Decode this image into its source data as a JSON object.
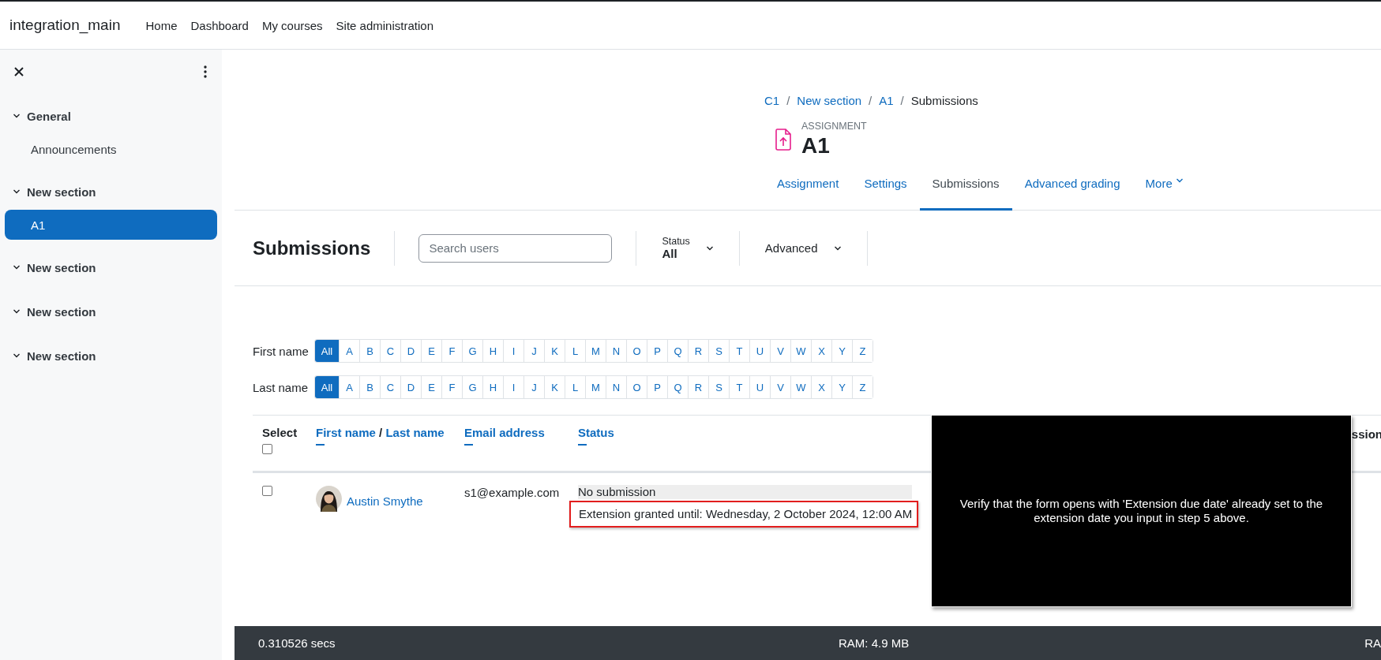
{
  "navbar": {
    "site_name": "integration_main",
    "links": [
      {
        "label": "Home"
      },
      {
        "label": "Dashboard"
      },
      {
        "label": "My courses"
      },
      {
        "label": "Site administration"
      }
    ]
  },
  "course_index": {
    "sections": [
      {
        "title": "General",
        "expanded": true,
        "items": [
          {
            "label": "Announcements",
            "selected": false
          }
        ]
      },
      {
        "title": "New section",
        "expanded": true,
        "items": [
          {
            "label": "A1",
            "selected": true
          }
        ]
      },
      {
        "title": "New section",
        "expanded": true
      },
      {
        "title": "New section",
        "expanded": true
      },
      {
        "title": "New section",
        "expanded": true
      }
    ]
  },
  "breadcrumb": [
    {
      "label": "C1",
      "link": true
    },
    {
      "separator_before": "/",
      "label": "New section",
      "link": true
    },
    {
      "separator_before": "/",
      "label": "A1",
      "link": true
    },
    {
      "separator_before": "/",
      "label": "Submissions",
      "link": false
    }
  ],
  "activity": {
    "type_label": "ASSIGNMENT",
    "title": "A1"
  },
  "tabs": [
    {
      "label": "Assignment",
      "selected": false,
      "has_menu": false
    },
    {
      "label": "Settings",
      "selected": false,
      "has_menu": false
    },
    {
      "label": "Submissions",
      "selected": true,
      "has_menu": false
    },
    {
      "label": "Advanced grading",
      "selected": false,
      "has_menu": false
    },
    {
      "label": "More",
      "selected": false,
      "has_menu": true
    }
  ],
  "toolbar": {
    "heading": "Submissions",
    "search": {
      "placeholder": "Search users"
    },
    "status_filter": {
      "label": "Status",
      "value": "All"
    },
    "advanced": {
      "label": "Advanced"
    }
  },
  "initials_bars": [
    {
      "label": "First name",
      "letters": [
        {
          "text": "All",
          "selected": true
        },
        {
          "text": "A",
          "selected": false
        },
        {
          "text": "B",
          "selected": false
        },
        {
          "text": "C",
          "selected": false
        },
        {
          "text": "D",
          "selected": false
        },
        {
          "text": "E",
          "selected": false
        },
        {
          "text": "F",
          "selected": false
        },
        {
          "text": "G",
          "selected": false
        },
        {
          "text": "H",
          "selected": false
        },
        {
          "text": "I",
          "selected": false
        },
        {
          "text": "J",
          "selected": false
        },
        {
          "text": "K",
          "selected": false
        },
        {
          "text": "L",
          "selected": false
        },
        {
          "text": "M",
          "selected": false
        },
        {
          "text": "N",
          "selected": false
        },
        {
          "text": "O",
          "selected": false
        },
        {
          "text": "P",
          "selected": false
        },
        {
          "text": "Q",
          "selected": false
        },
        {
          "text": "R",
          "selected": false
        },
        {
          "text": "S",
          "selected": false
        },
        {
          "text": "T",
          "selected": false
        },
        {
          "text": "U",
          "selected": false
        },
        {
          "text": "V",
          "selected": false
        },
        {
          "text": "W",
          "selected": false
        },
        {
          "text": "X",
          "selected": false
        },
        {
          "text": "Y",
          "selected": false
        },
        {
          "text": "Z",
          "selected": false
        }
      ]
    },
    {
      "label": "Last name",
      "letters": [
        {
          "text": "All",
          "selected": true
        },
        {
          "text": "A",
          "selected": false
        },
        {
          "text": "B",
          "selected": false
        },
        {
          "text": "C",
          "selected": false
        },
        {
          "text": "D",
          "selected": false
        },
        {
          "text": "E",
          "selected": false
        },
        {
          "text": "F",
          "selected": false
        },
        {
          "text": "G",
          "selected": false
        },
        {
          "text": "H",
          "selected": false
        },
        {
          "text": "I",
          "selected": false
        },
        {
          "text": "J",
          "selected": false
        },
        {
          "text": "K",
          "selected": false
        },
        {
          "text": "L",
          "selected": false
        },
        {
          "text": "M",
          "selected": false
        },
        {
          "text": "N",
          "selected": false
        },
        {
          "text": "O",
          "selected": false
        },
        {
          "text": "P",
          "selected": false
        },
        {
          "text": "Q",
          "selected": false
        },
        {
          "text": "R",
          "selected": false
        },
        {
          "text": "S",
          "selected": false
        },
        {
          "text": "T",
          "selected": false
        },
        {
          "text": "U",
          "selected": false
        },
        {
          "text": "V",
          "selected": false
        },
        {
          "text": "W",
          "selected": false
        },
        {
          "text": "X",
          "selected": false
        },
        {
          "text": "Y",
          "selected": false
        },
        {
          "text": "Z",
          "selected": false
        }
      ]
    }
  ],
  "table": {
    "select_all": {
      "label": "Select",
      "checked": false
    },
    "columns": [
      {
        "kind": "name",
        "first": "First name",
        "separator": "/",
        "last": "Last name"
      },
      {
        "kind": "sort",
        "label": "Email address"
      },
      {
        "kind": "sort",
        "label": "Status"
      },
      {
        "kind": "cut",
        "label": "ssion"
      }
    ],
    "rows": [
      {
        "checked": false,
        "name": "Austin Smythe",
        "email": "s1@example.com",
        "status": "No submission",
        "extension": "Extension granted until: Wednesday, 2 October 2024, 12:00 AM",
        "extension_highlighted": true
      }
    ]
  },
  "step_overlay": {
    "text": "Verify that the form opens with 'Extension due date' already set to the extension date you input in step 5 above."
  },
  "footer": {
    "timing": "0.310526 secs",
    "ram": "RAM: 4.9 MB",
    "cut_text": "RA"
  }
}
